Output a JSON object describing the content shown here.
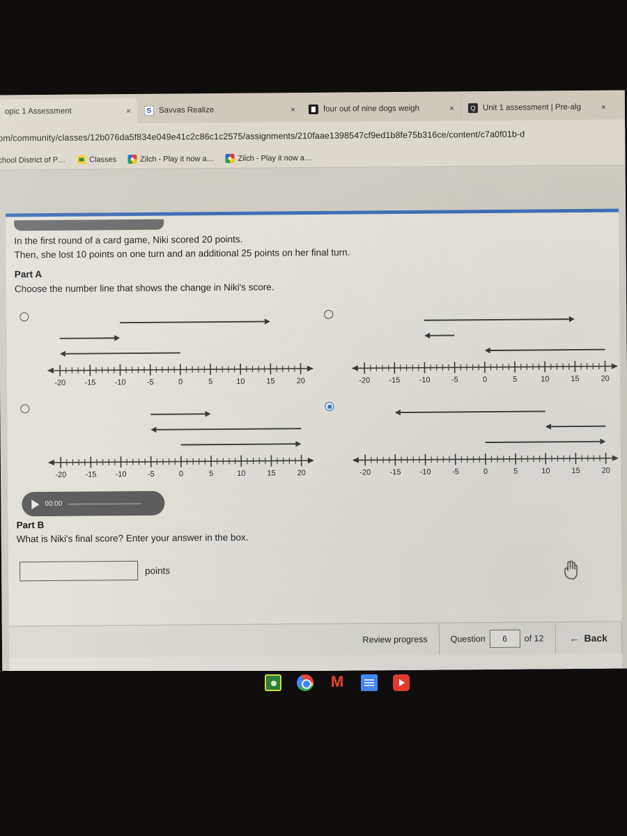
{
  "browser": {
    "tabs": [
      {
        "title": "opic 1 Assessment",
        "favicon": "none",
        "active": true,
        "close_label": "×"
      },
      {
        "title": "Savvas Realize",
        "favicon": "savvas-favicon",
        "active": false,
        "close_label": "×"
      },
      {
        "title": "four out of nine dogs weigh",
        "favicon": "document-favicon",
        "active": false,
        "close_label": "×"
      },
      {
        "title": "Unit 1 assessment | Pre-alg",
        "favicon": "quizizz-favicon",
        "active": false,
        "close_label": "×"
      }
    ],
    "url": "om/community/classes/12b076da5f834e049e41c2c86c1c2575/assignments/210faae1398547cf9ed1b8fe75b316ce/content/c7a0f01b-d",
    "bookmarks": [
      {
        "label": "chool District of P…",
        "icon": "none"
      },
      {
        "label": "Classes",
        "icon": "classroom-icon"
      },
      {
        "label": "Zilch - Play it now a…",
        "icon": "zilch-icon"
      },
      {
        "label": "Zilch - Play it now a…",
        "icon": "zilch-icon"
      }
    ]
  },
  "question": {
    "stem_line1": "In the first round of a card game, Niki scored 20 points.",
    "stem_line2": "Then, she lost 10 points on one turn and an additional 25 points on her final turn.",
    "part_a_label": "Part A",
    "part_a_prompt": "Choose the number line that shows the change in Niki's score.",
    "part_b_label": "Part B",
    "part_b_prompt": "What is Niki's final score? Enter your answer in the box.",
    "answer_value": "",
    "answer_placeholder": "",
    "answer_units": "points"
  },
  "audio": {
    "time": "00:00",
    "play_label": "play-button"
  },
  "nav": {
    "review_progress": "Review progress",
    "question_label": "Question",
    "question_number": "6",
    "of_label": "of 12",
    "back_label": "Back",
    "back_arrow": "←"
  },
  "shelf": {
    "icons": [
      "classroom-icon",
      "chrome-icon",
      "gmail-icon",
      "docs-icon",
      "youtube-icon"
    ]
  },
  "colors": {
    "accent_blue": "#2f6fd0",
    "page_top_border": "#3e6fb6",
    "arrow_stroke": "#3a3a35",
    "card_bg": "#e3e1da"
  },
  "chart_data": [
    {
      "id": "option-a",
      "type": "line",
      "title": "Number line option A (top-left)",
      "selected": false,
      "xlabel": "",
      "ylabel": "",
      "xlim": [
        -22,
        22
      ],
      "ticks_major": [
        -20,
        -15,
        -10,
        -5,
        0,
        5,
        10,
        15,
        20
      ],
      "tick_labels": [
        "-20",
        "-15",
        "-10",
        "-5",
        "0",
        "5",
        "10",
        "15",
        "20"
      ],
      "minor_tick_step": 1,
      "grid": false,
      "arrows": [
        {
          "from": -10,
          "to": 15,
          "direction": "right",
          "row": 1
        },
        {
          "from": -20,
          "to": -10,
          "direction": "right",
          "row": 2
        },
        {
          "from": 0,
          "to": -20,
          "direction": "left",
          "row": 3
        }
      ]
    },
    {
      "id": "option-b",
      "type": "line",
      "title": "Number line option B (top-right)",
      "selected": false,
      "xlabel": "",
      "ylabel": "",
      "xlim": [
        -22,
        22
      ],
      "ticks_major": [
        -20,
        -15,
        -10,
        -5,
        0,
        5,
        10,
        15,
        20
      ],
      "tick_labels": [
        "-20",
        "-15",
        "-10",
        "-5",
        "0",
        "5",
        "10",
        "15",
        "20"
      ],
      "minor_tick_step": 1,
      "grid": false,
      "arrows": [
        {
          "from": -10,
          "to": 15,
          "direction": "right",
          "row": 1
        },
        {
          "from": -5,
          "to": -10,
          "direction": "left",
          "row": 2
        },
        {
          "from": 20,
          "to": 0,
          "direction": "left",
          "row": 3
        }
      ]
    },
    {
      "id": "option-c",
      "type": "line",
      "title": "Number line option C (bottom-left)",
      "selected": false,
      "xlabel": "",
      "ylabel": "",
      "xlim": [
        -22,
        22
      ],
      "ticks_major": [
        -20,
        -15,
        -10,
        -5,
        0,
        5,
        10,
        15,
        20
      ],
      "tick_labels": [
        "-20",
        "-15",
        "-10",
        "-5",
        "0",
        "5",
        "10",
        "15",
        "20"
      ],
      "minor_tick_step": 1,
      "grid": false,
      "arrows": [
        {
          "from": -5,
          "to": 5,
          "direction": "right",
          "row": 1
        },
        {
          "from": 20,
          "to": -5,
          "direction": "left",
          "row": 2
        },
        {
          "from": 0,
          "to": 20,
          "direction": "right",
          "row": 3
        }
      ]
    },
    {
      "id": "option-d",
      "type": "line",
      "title": "Number line option D (bottom-right)",
      "selected": true,
      "xlabel": "",
      "ylabel": "",
      "xlim": [
        -22,
        22
      ],
      "ticks_major": [
        -20,
        -15,
        -10,
        -5,
        0,
        5,
        10,
        15,
        20
      ],
      "tick_labels": [
        "-20",
        "-15",
        "-10",
        "-5",
        "0",
        "5",
        "10",
        "15",
        "20"
      ],
      "minor_tick_step": 1,
      "grid": false,
      "arrows": [
        {
          "from": 10,
          "to": -15,
          "direction": "left",
          "row": 1
        },
        {
          "from": 20,
          "to": 10,
          "direction": "left",
          "row": 2
        },
        {
          "from": 0,
          "to": 20,
          "direction": "right",
          "row": 3
        }
      ]
    }
  ]
}
